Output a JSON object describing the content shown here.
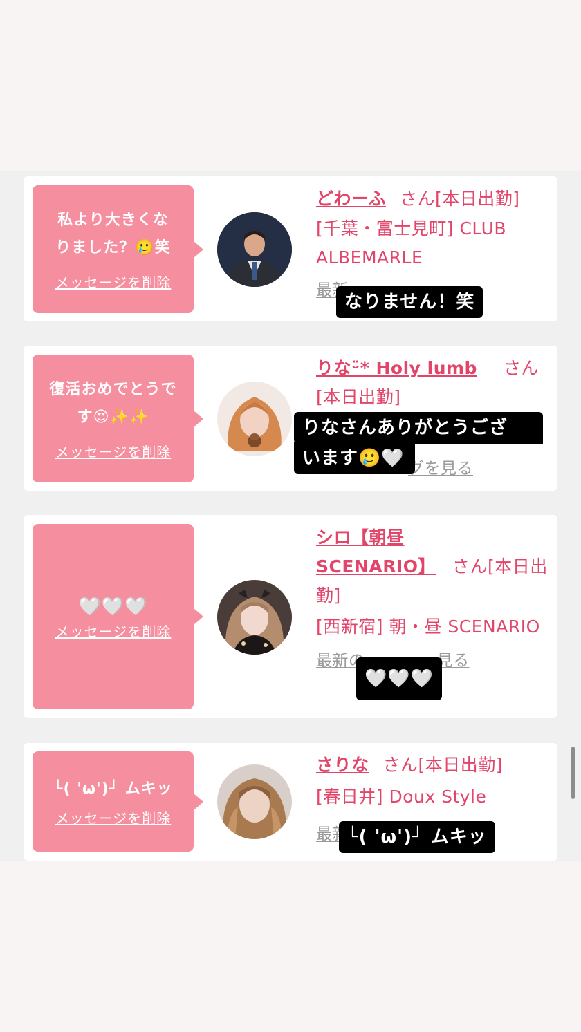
{
  "cards": [
    {
      "message": "私より大きくなりました？🥲笑",
      "delete_label": "メッセージを削除",
      "name": "どわーふ",
      "san": "さん[本日出勤]",
      "shop": "[千葉・富士見町] CLUB ALBEMARLE",
      "latest_visible": "最新",
      "caption": "なりません！笑"
    },
    {
      "message": "復活おめでとうです😍✨✨",
      "delete_label": "メッセージを削除",
      "name": "りなᵕ̈* Holy lumb",
      "san": "さん",
      "status": "[本日出勤]",
      "latest_visible": "グを見る",
      "caption_line1": "りなさんありがとうござ",
      "caption_line2": "います🥲🤍"
    },
    {
      "message": "🤍🤍🤍",
      "delete_label": "メッセージを削除",
      "name_line1": "シロ【朝昼",
      "name_line2": "SCENARIO】",
      "san": "さん[本日出勤]",
      "shop": "[西新宿] 朝・昼 SCENARIO",
      "latest_visible_left": "最新の",
      "latest_visible_right": "見る",
      "caption": "🤍🤍🤍"
    },
    {
      "message": "└( 'ω')┘ ムキッ",
      "delete_label": "メッセージを削除",
      "name": "さりな",
      "san": "さん[本日出勤]",
      "shop": "[春日井] Doux Style",
      "latest_visible": "最新",
      "caption": "└( 'ω')┘ ムキッ"
    }
  ],
  "colors": {
    "bubble": "#f58e9e",
    "accent": "#e2456a",
    "link_gray": "#9a9a9a",
    "caption_bg": "#000000"
  }
}
